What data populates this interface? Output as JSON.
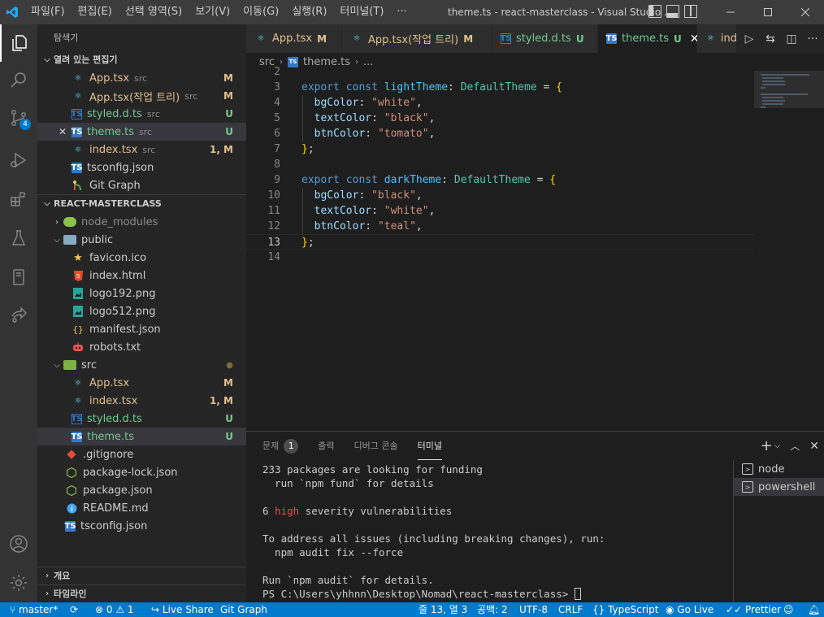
{
  "titlebar": {
    "menus": [
      "파일(F)",
      "편집(E)",
      "선택 영역(S)",
      "보기(V)",
      "이동(G)",
      "실행(R)",
      "터미널(T)",
      "···"
    ],
    "title": "theme.ts - react-masterclass - Visual Studio ..."
  },
  "activity": {
    "scm_badge": "4"
  },
  "sidebar": {
    "title": "탐색기",
    "open_editors": {
      "header": "열려 있는 편집기",
      "items": [
        {
          "name": "App.tsx",
          "dir": "src",
          "status": "M"
        },
        {
          "name": "App.tsx(작업 트리)",
          "dir": "src",
          "status": "M"
        },
        {
          "name": "styled.d.ts",
          "dir": "src",
          "status": "U"
        },
        {
          "name": "theme.ts",
          "dir": "src",
          "status": "U"
        },
        {
          "name": "index.tsx",
          "dir": "src",
          "status": "1, M"
        },
        {
          "name": "tsconfig.json",
          "dir": "",
          "status": ""
        },
        {
          "name": "Git Graph",
          "dir": "",
          "status": ""
        }
      ]
    },
    "project": {
      "header": "REACT-MASTERCLASS",
      "items": [
        {
          "name": "node_modules",
          "status": ""
        },
        {
          "name": "public",
          "status": ""
        },
        {
          "name": "favicon.ico",
          "status": ""
        },
        {
          "name": "index.html",
          "status": ""
        },
        {
          "name": "logo192.png",
          "status": ""
        },
        {
          "name": "logo512.png",
          "status": ""
        },
        {
          "name": "manifest.json",
          "status": ""
        },
        {
          "name": "robots.txt",
          "status": ""
        },
        {
          "name": "src",
          "status": "●"
        },
        {
          "name": "App.tsx",
          "status": "M"
        },
        {
          "name": "index.tsx",
          "status": "1, M"
        },
        {
          "name": "styled.d.ts",
          "status": "U"
        },
        {
          "name": "theme.ts",
          "status": "U"
        },
        {
          "name": ".gitignore",
          "status": ""
        },
        {
          "name": "package-lock.json",
          "status": ""
        },
        {
          "name": "package.json",
          "status": ""
        },
        {
          "name": "README.md",
          "status": ""
        },
        {
          "name": "tsconfig.json",
          "status": ""
        }
      ]
    },
    "outline": "개요",
    "timeline": "타임라인"
  },
  "tabs": [
    {
      "name": "App.tsx",
      "status": "M"
    },
    {
      "name": "App.tsx(작업 트리)",
      "status": "M"
    },
    {
      "name": "styled.d.ts",
      "status": "U"
    },
    {
      "name": "theme.ts",
      "status": "U"
    },
    {
      "name": "ind",
      "status": ""
    }
  ],
  "breadcrumb": {
    "folder": "src",
    "file": "theme.ts",
    "more": "..."
  },
  "editor": {
    "line_numbers": [
      "2",
      "3",
      "4",
      "5",
      "6",
      "7",
      "8",
      "9",
      "10",
      "11",
      "12",
      "13",
      "14"
    ],
    "l3": {
      "kw1": "export",
      "kw2": "const",
      "var": "lightTheme",
      "type": "DefaultTheme"
    },
    "l4": {
      "prop": "bgColor",
      "str": "\"white\""
    },
    "l5": {
      "prop": "textColor",
      "str": "\"black\""
    },
    "l6": {
      "prop": "btnColor",
      "str": "\"tomato\""
    },
    "l9": {
      "kw1": "export",
      "kw2": "const",
      "var": "darkTheme",
      "type": "DefaultTheme"
    },
    "l10": {
      "prop": "bgColor",
      "str": "\"black\""
    },
    "l11": {
      "prop": "textColor",
      "str": "\"white\""
    },
    "l12": {
      "prop": "btnColor",
      "str": "\"teal\""
    }
  },
  "panel": {
    "tabs": [
      "문제",
      "출력",
      "디버그 콘솔",
      "터미널"
    ],
    "problems_count": "1",
    "terminal_lines": {
      "t1": "233 packages are looking for funding",
      "t2": "  run `npm fund` for details",
      "t4a": "6 ",
      "t4b": "high",
      "t4c": " severity vulnerabilities",
      "t6": "To address all issues (including breaking changes), run:",
      "t7": "  npm audit fix --force",
      "t9": "Run `npm audit` for details.",
      "t10": "PS C:\\Users\\yhhnn\\Desktop\\Nomad\\react-masterclass> "
    },
    "terminals": [
      "node",
      "powershell"
    ]
  },
  "statusbar": {
    "branch": "master*",
    "errors": "0",
    "warnings": "1",
    "liveshare": "Live Share",
    "gitgraph": "Git Graph",
    "position": "줄 13, 열 3",
    "spaces": "공백: 2",
    "encoding": "UTF-8",
    "eol": "CRLF",
    "language": "TypeScript",
    "golive": "Go Live",
    "prettier": "Prettier"
  },
  "colors": {
    "accent": "#007acc",
    "modified": "#e2c08d",
    "untracked": "#73c991"
  }
}
